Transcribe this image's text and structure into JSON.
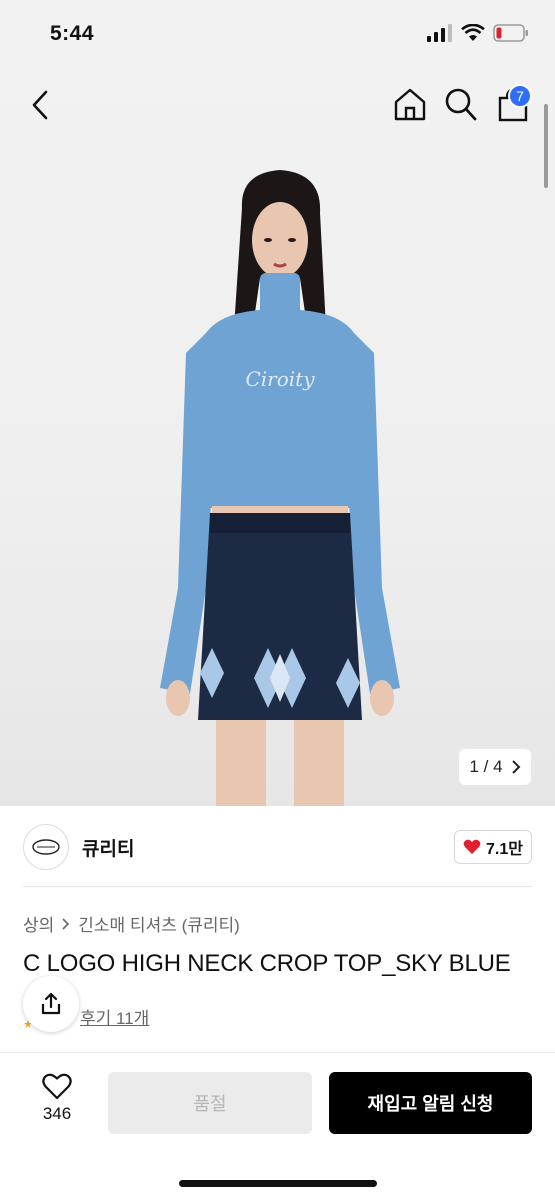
{
  "status_bar": {
    "time": "5:44"
  },
  "nav": {
    "cart_count": "7"
  },
  "product_image": {
    "page_current": "1",
    "page_total": "4",
    "page_separator": "/",
    "sweater_color": "#6fa3d4",
    "skirt_color": "#1d2a44"
  },
  "brand": {
    "name": "큐리티",
    "like_count": "7.1만"
  },
  "breadcrumb": {
    "items": [
      "상의",
      "긴소매 티셔츠 (큐리티)"
    ],
    "separator": ">"
  },
  "product": {
    "title": "C LOGO HIGH NECK CROP TOP_SKY BLUE",
    "review_label": "후기 11개"
  },
  "actions": {
    "wish_count": "346",
    "soldout_label": "품절",
    "restock_label": "재입고 알림 신청"
  },
  "colors": {
    "accent_badge": "#2f6ef5",
    "like_heart": "#e0202e",
    "primary_button": "#000000"
  }
}
